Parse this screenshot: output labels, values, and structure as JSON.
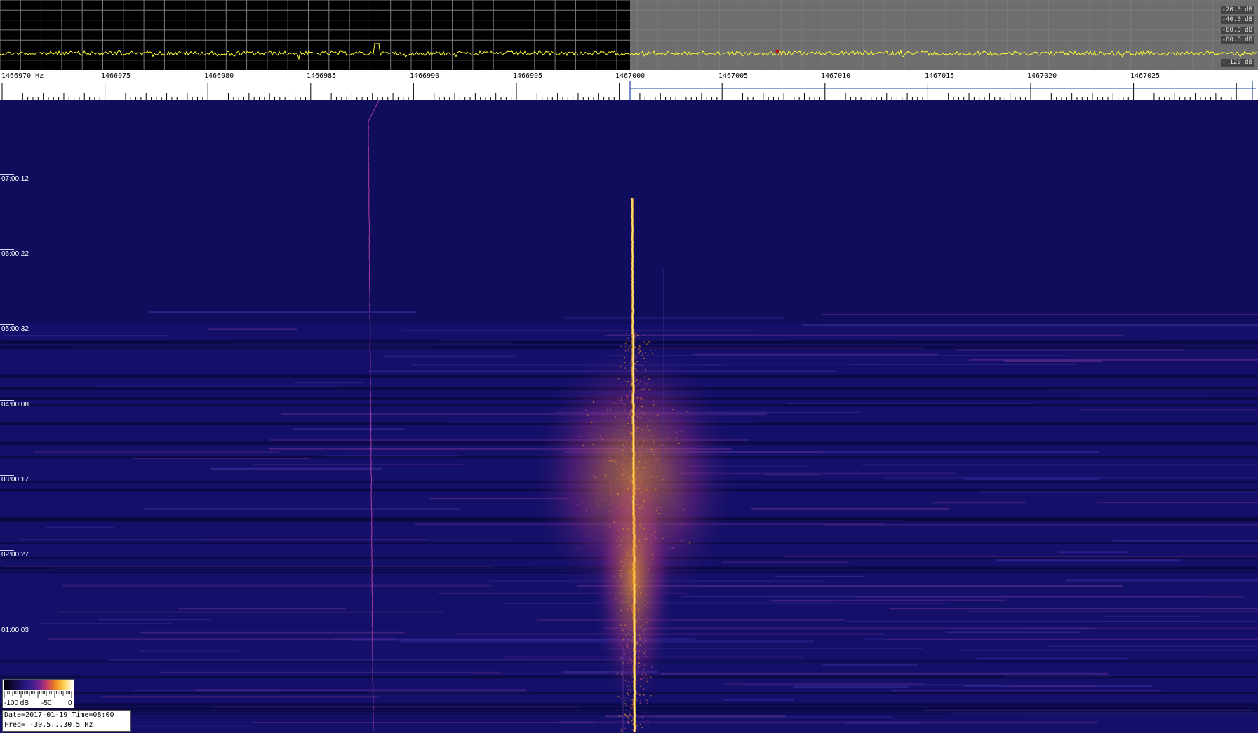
{
  "spectrum": {
    "db_labels": [
      "-20.0 dB",
      "-40.0 dB",
      "-60.0 dB",
      "-80.0 dB",
      "- 120 dB"
    ],
    "colors": {
      "left_bg": "#000000",
      "right_bg": "#6e6e6e",
      "grid": "#7a7a7a",
      "trace": "#ffff33"
    }
  },
  "ruler": {
    "unit": "Hz",
    "labels": [
      "1466970 Hz",
      "1466975",
      "1466980",
      "1466985",
      "1466990",
      "1466995",
      "1467000",
      "1467005",
      "1467010",
      "1467015",
      "1467020",
      "1467025"
    ]
  },
  "waterfall": {
    "time_labels": [
      "07:00:12",
      "06:00:22",
      "05:00:32",
      "04:00:08",
      "03:00:17",
      "02:00:27",
      "01:00:03"
    ],
    "colors": {
      "background": "#14106a",
      "signal_core": "#ffe680",
      "signal_glow": "#f0a020",
      "drift_line": "#b040a0"
    }
  },
  "colorbar": {
    "min_label": "-100 dB",
    "mid_label": "-50",
    "max_label": "0"
  },
  "info": {
    "date_line": "Date=2017-01-19 Time=08:00",
    "freq_line": "Freq= -30.5...30.5 Hz"
  }
}
